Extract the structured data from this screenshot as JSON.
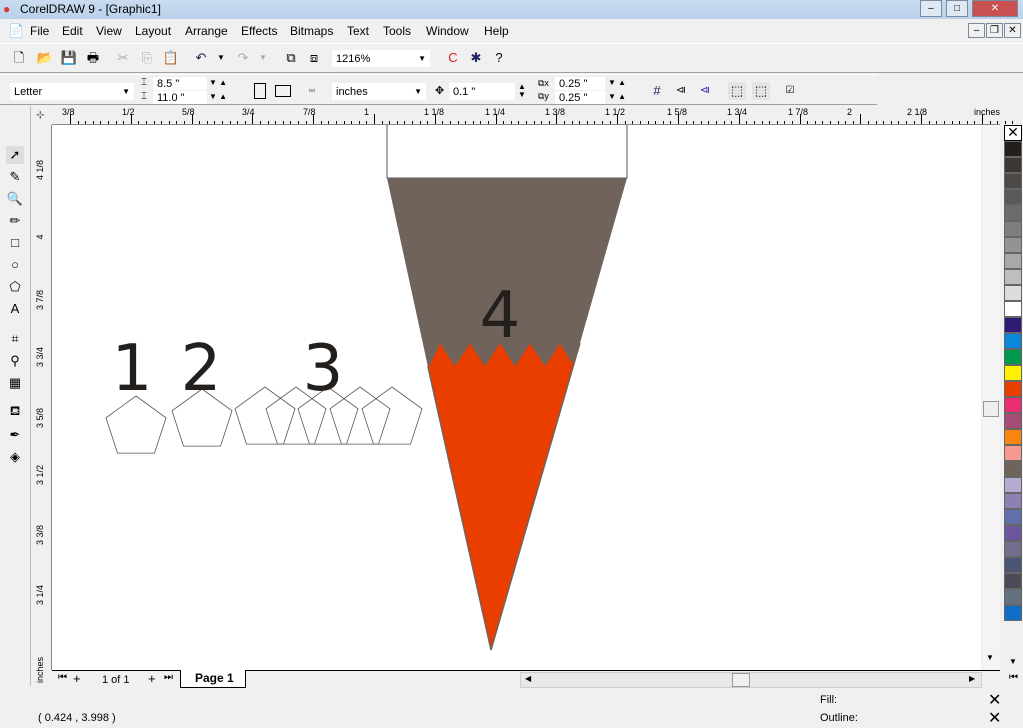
{
  "window": {
    "title": "CorelDRAW 9 - [Graphic1]"
  },
  "menu": [
    "File",
    "Edit",
    "View",
    "Layout",
    "Arrange",
    "Effects",
    "Bitmaps",
    "Text",
    "Tools",
    "Window",
    "Help"
  ],
  "toolbar": {
    "zoom": "1216%"
  },
  "property_bar": {
    "paper": "Letter",
    "width": "8.5 \"",
    "height": "11.0 \"",
    "units": "inches",
    "nudge": "0.1 \"",
    "dup_x": "0.25 \"",
    "dup_y": "0.25 \""
  },
  "hruler": [
    "3/8",
    "1/2",
    "5/8",
    "3/4",
    "7/8",
    "1",
    "1  1/8",
    "1  1/4",
    "1  3/8",
    "1  1/2",
    "1  5/8",
    "1  3/4",
    "1  7/8",
    "2",
    "2  1/8",
    "inches"
  ],
  "vruler": [
    "4  1/8",
    "4",
    "3  7/8",
    "3  3/4",
    "3  5/8",
    "3  1/2",
    "3  3/8",
    "3  1/4",
    "inches"
  ],
  "canvas": {
    "labels": [
      "1",
      "2",
      "3",
      "4"
    ],
    "colors": {
      "gray": "#70635b",
      "orange": "#ea3d00"
    }
  },
  "palette": [
    "#231f1c",
    "#3b3734",
    "#4b4846",
    "#5c5a58",
    "#6e6c6a",
    "#7f7d7c",
    "#949392",
    "#a9a8a8",
    "#bfbebe",
    "#dcdcdc",
    "#ffffff",
    "#2e1a74",
    "#0a87d8",
    "#00994c",
    "#fff200",
    "#ea3d00",
    "#ec2d72",
    "#a64a78",
    "#f7860f",
    "#f69a8f",
    "#70635b",
    "#b6aad0",
    "#8d80b5",
    "#6070ac",
    "#6b569e",
    "#716e8e",
    "#4b5574",
    "#4c4a57",
    "#637180",
    "#0f6fc6"
  ],
  "pages": {
    "counter": "1 of 1",
    "tab": "Page 1"
  },
  "status": {
    "coords": "( 0.424 , 3.998 )",
    "fill_label": "Fill:",
    "outline_label": "Outline:"
  }
}
